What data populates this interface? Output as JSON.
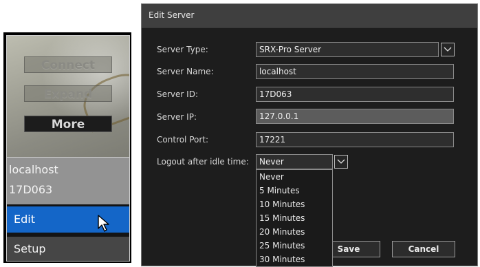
{
  "tile": {
    "buttons": {
      "connect": "Connect",
      "expand": "Expand",
      "more": "More"
    },
    "server_name": "localhost",
    "server_id": "17D063",
    "menu": {
      "edit": "Edit",
      "setup": "Setup"
    }
  },
  "dialog": {
    "title": "Edit Server",
    "fields": {
      "server_type": {
        "label": "Server Type:",
        "value": "SRX-Pro Server"
      },
      "server_name": {
        "label": "Server Name:",
        "value": "localhost"
      },
      "server_id": {
        "label": "Server ID:",
        "value": "17D063"
      },
      "server_ip": {
        "label": "Server IP:",
        "value": "127.0.0.1"
      },
      "control_port": {
        "label": "Control Port:",
        "value": "17221"
      },
      "logout": {
        "label": "Logout after idle time:",
        "value": "Never"
      }
    },
    "logout_options": [
      "Never",
      "5 Minutes",
      "10 Minutes",
      "15 Minutes",
      "20 Minutes",
      "25 Minutes",
      "30 Minutes"
    ],
    "buttons": {
      "save": "Save",
      "cancel": "Cancel"
    }
  },
  "icons": {
    "dropdown": "chevron-down-icon",
    "cursor": "mouse-pointer-icon"
  },
  "colors": {
    "selection": "#1466c8",
    "dialog_bg": "#1d1d1d",
    "titlebar": "#3f3f3f"
  }
}
